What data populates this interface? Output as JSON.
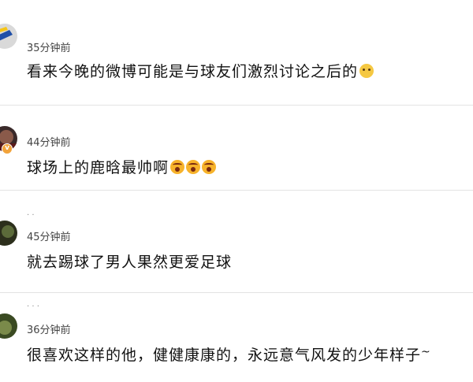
{
  "comments": [
    {
      "time": "35分钟前",
      "text": "看来今晚的微博可能是与球友们激烈讨论之后的",
      "emoji": "doge-emoji"
    },
    {
      "time": "44分钟前",
      "text": "球场上的鹿晗最帅啊",
      "emoji": "fear-emoji"
    },
    {
      "time": "45分钟前",
      "text": "就去踢球了男人果然更爱足球"
    },
    {
      "time": "36分钟前",
      "text": "很喜欢这样的他，健健康康的，永远意气风发的少年样子",
      "suffix": "~"
    }
  ],
  "colors": {
    "badge": "#f2a33a",
    "divider": "#e3e3e3"
  }
}
